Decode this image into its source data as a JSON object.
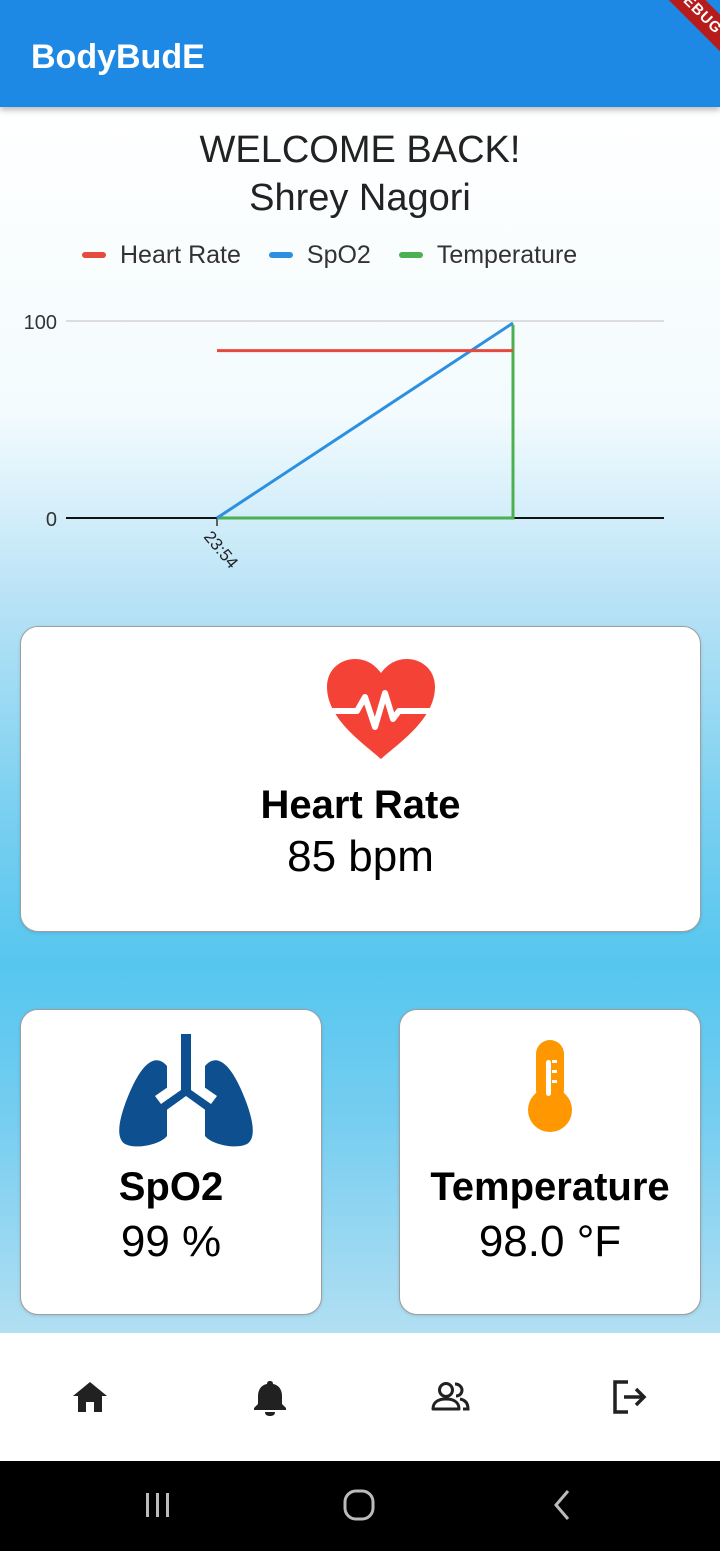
{
  "app": {
    "title": "BodyBudE",
    "debug_banner": "DEBUG"
  },
  "welcome": {
    "line1": "WELCOME BACK!",
    "user_name": "Shrey Nagori"
  },
  "legend": [
    {
      "label": "Heart Rate",
      "color": "#E64A3D"
    },
    {
      "label": "SpO2",
      "color": "#2C8FE0"
    },
    {
      "label": "Temperature",
      "color": "#4CAF50"
    }
  ],
  "chart_data": {
    "type": "line",
    "y_ticks": [
      "0",
      "100"
    ],
    "ylim": [
      0,
      100
    ],
    "x_tick_labels": [
      "23:54"
    ],
    "grid": true,
    "legend_position": "top",
    "series": [
      {
        "name": "Heart Rate",
        "color": "#E64A3D",
        "x": [
          0,
          1
        ],
        "y": [
          85,
          85
        ]
      },
      {
        "name": "SpO2",
        "color": "#2C8FE0",
        "x": [
          0,
          1
        ],
        "y": [
          0,
          99
        ]
      },
      {
        "name": "Temperature",
        "color": "#4CAF50",
        "x": [
          0,
          1,
          1
        ],
        "y": [
          0,
          0,
          98
        ]
      }
    ]
  },
  "cards": {
    "heart_rate": {
      "title": "Heart Rate",
      "value": "85 bpm",
      "icon": "heart-pulse-icon",
      "color": "#F44336"
    },
    "spo2": {
      "title": "SpO2",
      "value": "99 %",
      "icon": "lungs-icon",
      "color": "#0D4F8F"
    },
    "temperature": {
      "title": "Temperature",
      "value": "98.0 °F",
      "icon": "thermometer-icon",
      "color": "#FF9800"
    }
  },
  "nav": [
    {
      "icon": "home-icon"
    },
    {
      "icon": "bell-icon"
    },
    {
      "icon": "people-icon"
    },
    {
      "icon": "logout-icon"
    }
  ],
  "system_nav": [
    {
      "icon": "recents-icon"
    },
    {
      "icon": "home-circle-icon"
    },
    {
      "icon": "back-icon"
    }
  ]
}
